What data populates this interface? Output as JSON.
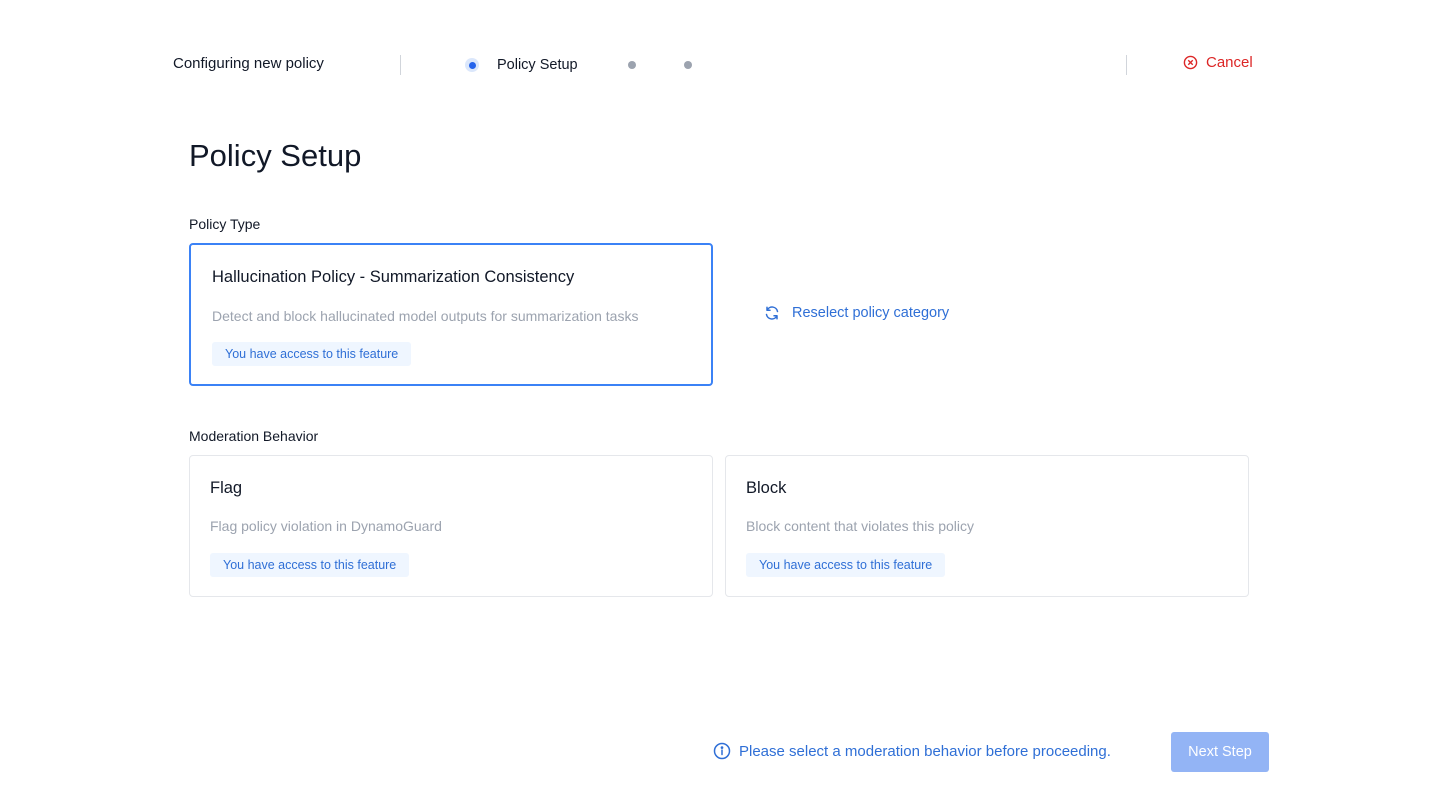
{
  "header": {
    "title": "Configuring new policy",
    "steps": [
      {
        "label": "Policy Setup",
        "state": "active"
      },
      {
        "label": "",
        "state": "inactive"
      },
      {
        "label": "",
        "state": "inactive"
      }
    ],
    "cancel_label": "Cancel",
    "cancel_icon": "circle-x-icon"
  },
  "main": {
    "title": "Policy Setup",
    "policy_type": {
      "label": "Policy Type",
      "card": {
        "title": "Hallucination Policy - Summarization Consistency",
        "description": "Detect and block hallucinated model outputs for summarization tasks",
        "badge": "You have access to this feature",
        "selected": true
      },
      "reselect_label": "Reselect policy category",
      "reselect_icon": "refresh-icon"
    },
    "moderation": {
      "label": "Moderation Behavior",
      "options": [
        {
          "title": "Flag",
          "description": "Flag policy violation in DynamoGuard",
          "badge": "You have access to this feature"
        },
        {
          "title": "Block",
          "description": "Block content that violates this policy",
          "badge": "You have access to this feature"
        }
      ]
    }
  },
  "footer": {
    "notice": "Please select a moderation behavior before proceeding.",
    "notice_icon": "info-icon",
    "next_label": "Next Step"
  },
  "colors": {
    "accent": "#2563eb",
    "link": "#2f6fd6",
    "danger": "#dc2626",
    "button_disabled": "#93b4f5",
    "badge_bg": "#eff6ff",
    "muted_text": "#9ca3af"
  }
}
